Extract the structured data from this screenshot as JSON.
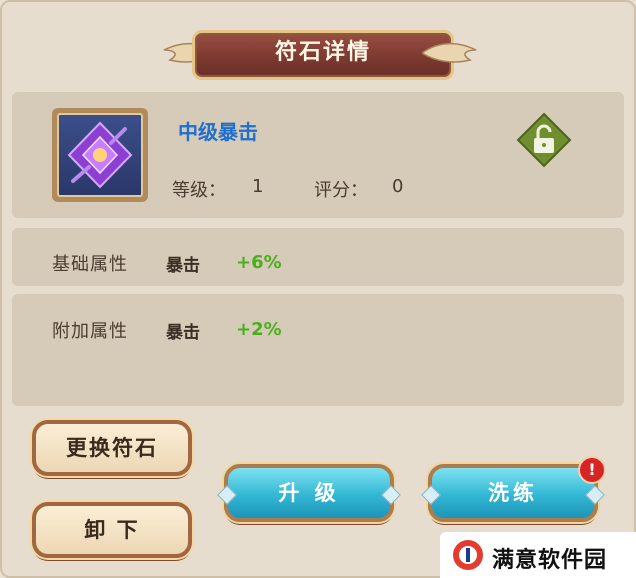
{
  "title": "符石详情",
  "rune": {
    "name": "中级暴击",
    "level_label": "等级：",
    "level_value": "1",
    "score_label": "评分：",
    "score_value": "0",
    "lock_state": "unlocked-lock-icon"
  },
  "base_attr": {
    "label": "基础属性",
    "name": "暴击",
    "value": "+6%"
  },
  "extra_attr": {
    "label": "附加属性",
    "name": "暴击",
    "value": "+2%"
  },
  "buttons": {
    "replace": "更换符石",
    "unload": "卸 下",
    "upgrade": "升 级",
    "refine": "洗练"
  },
  "alert": "!",
  "logo": {
    "text": "满意软件园"
  },
  "colors": {
    "name_blue": "#1f6fcf",
    "bonus_green": "#49b01c",
    "title_bg": "#7a3830"
  }
}
